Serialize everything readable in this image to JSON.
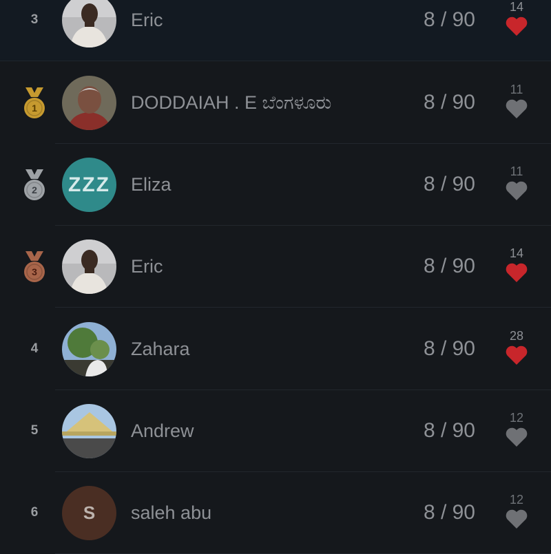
{
  "colors": {
    "background": "#15181c",
    "pinned_row": "#131a22",
    "heart_liked": "#c8262b",
    "heart_unliked": "#6f7175",
    "gold": "#c69a2f",
    "silver": "#9ea2a6",
    "bronze": "#a8654a"
  },
  "rows": [
    {
      "rank": "3",
      "medal": "",
      "name": "Eric",
      "score": "8 / 90",
      "likes": "14",
      "liked": true,
      "avatar": "photo-man-white-shirt",
      "pinned": true
    },
    {
      "rank": "1",
      "medal": "gold",
      "name": "DODDAIAH . E ಬೆಂಗಳೂರು",
      "score": "8 / 90",
      "likes": "11",
      "liked": false,
      "avatar": "photo-older-man"
    },
    {
      "rank": "2",
      "medal": "silver",
      "name": "Eliza",
      "score": "8 / 90",
      "likes": "11",
      "liked": false,
      "avatar": "zzz",
      "avatar_text": "ZZZ"
    },
    {
      "rank": "3",
      "medal": "bronze",
      "name": "Eric",
      "score": "8 / 90",
      "likes": "14",
      "liked": true,
      "avatar": "photo-man-white-shirt"
    },
    {
      "rank": "4",
      "medal": "",
      "name": "Zahara",
      "score": "8 / 90",
      "likes": "28",
      "liked": true,
      "avatar": "photo-trees-sky"
    },
    {
      "rank": "5",
      "medal": "",
      "name": "Andrew",
      "score": "8 / 90",
      "likes": "12",
      "liked": false,
      "avatar": "photo-straw-hat"
    },
    {
      "rank": "6",
      "medal": "",
      "name": "saleh abu",
      "score": "8 / 90",
      "likes": "12",
      "liked": false,
      "avatar": "letter",
      "avatar_text": "S"
    }
  ]
}
